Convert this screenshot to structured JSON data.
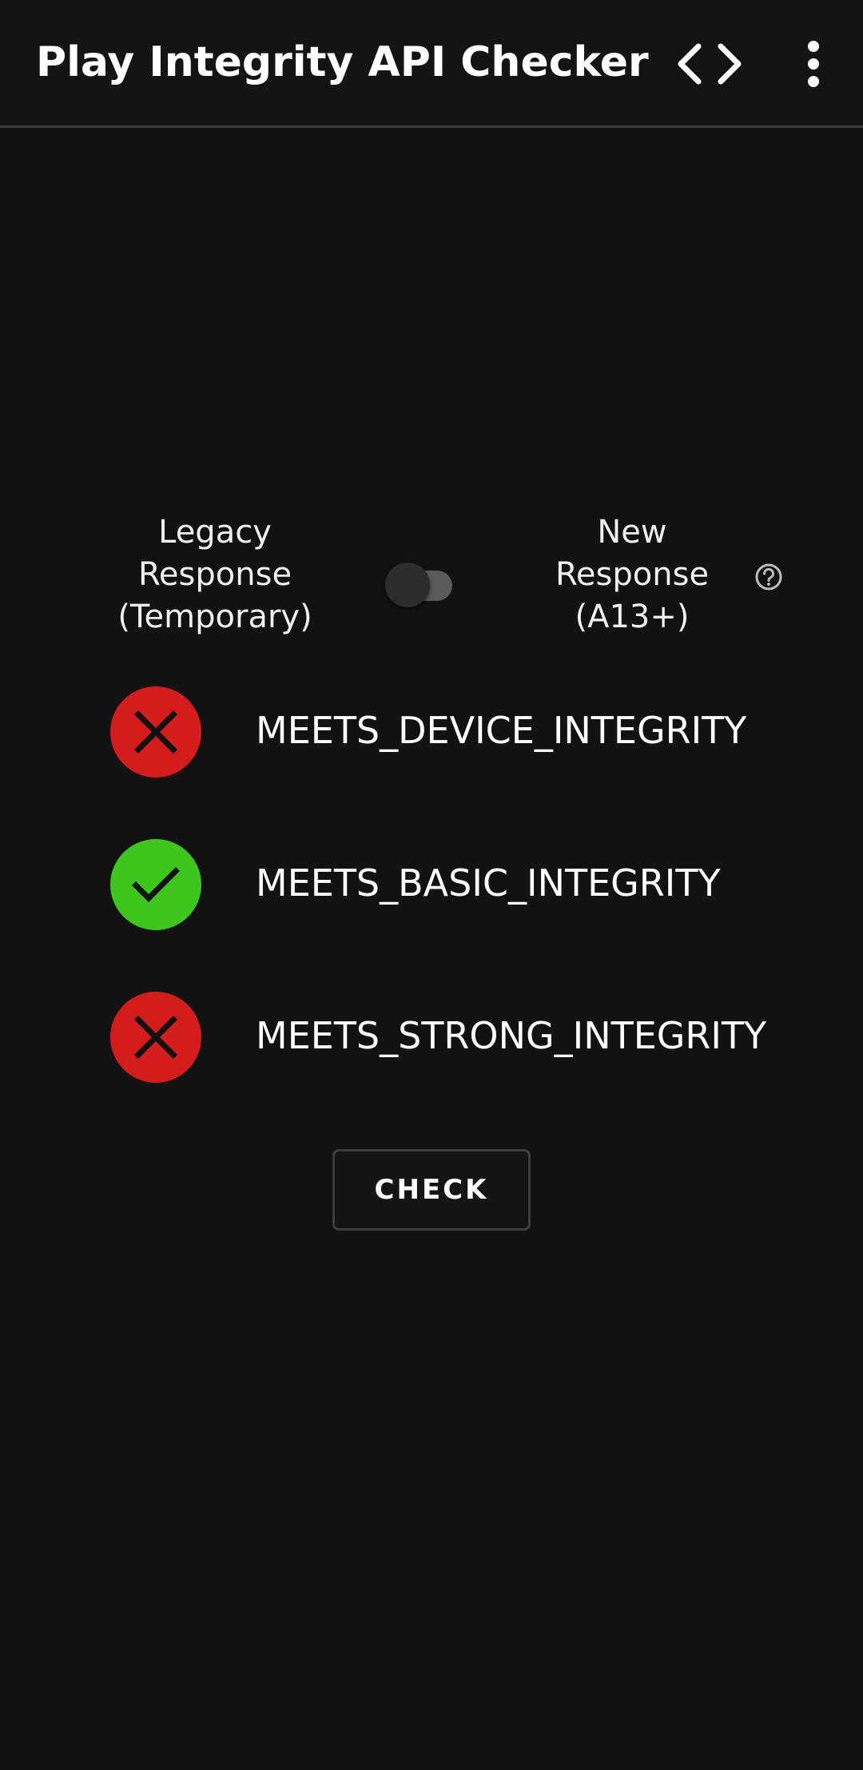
{
  "toolbar": {
    "title": "Play Integrity API Checker",
    "code_icon": "code-icon",
    "more_icon": "more-vert-icon"
  },
  "response_toggle": {
    "left_label": "Legacy\nResponse\n(Temporary)",
    "right_label": "New\nResponse\n(A13+)",
    "state": "off",
    "help_icon": "help-circle-icon"
  },
  "results": [
    {
      "label": "MEETS_DEVICE_INTEGRITY",
      "status": "fail",
      "icon": "close-icon",
      "color": "#d31c1c"
    },
    {
      "label": "MEETS_BASIC_INTEGRITY",
      "status": "pass",
      "icon": "check-icon",
      "color": "#3ec51e"
    },
    {
      "label": "MEETS_STRONG_INTEGRITY",
      "status": "fail",
      "icon": "close-icon",
      "color": "#d31c1c"
    }
  ],
  "check_button": {
    "label": "CHECK"
  },
  "colors": {
    "background": "#121212",
    "fail": "#d31c1c",
    "pass": "#3ec51e",
    "icon_dark": "#111111"
  }
}
